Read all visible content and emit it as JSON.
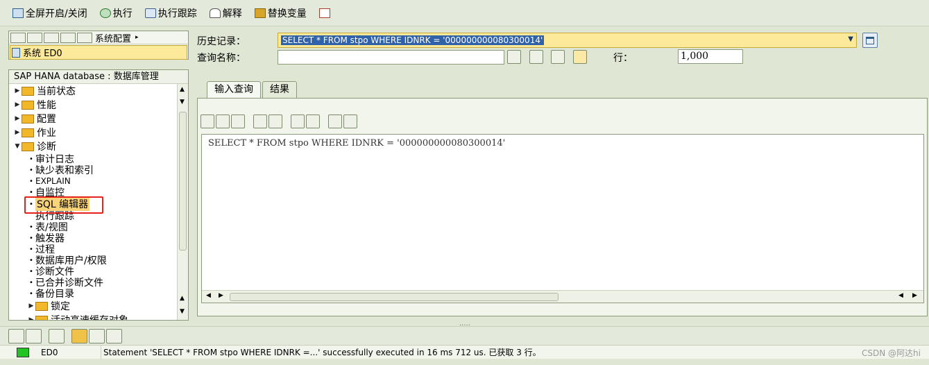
{
  "toolbar": {
    "fullscreen": "全屏开启/关闭",
    "execute": "执行",
    "exec_trace": "执行跟踪",
    "explain": "解释",
    "replace_vars": "替换变量"
  },
  "nav": {
    "system_config": "系统配置",
    "system": "系统 ED0"
  },
  "tree": {
    "header": "SAP HANA database : 数据库管理",
    "folders": {
      "current_state": "当前状态",
      "performance": "性能",
      "config": "配置",
      "jobs": "作业",
      "diagnosis": "诊断",
      "lock": "锁定",
      "active_cache": "活动高速缓存对象"
    },
    "leaves": {
      "audit_log": "审计日志",
      "missing_tables": "缺少表和索引",
      "explain": "EXPLAIN",
      "self_monitor": "自监控",
      "sql_editor": "SQL 编辑器",
      "exec_trace": "执行跟踪",
      "tables_views": "表/视图",
      "triggers": "触发器",
      "procedures": "过程",
      "db_users": "数据库用户/权限",
      "diag_files": "诊断文件",
      "merged_diag_files": "已合并诊断文件",
      "backup_catalog": "备份目录"
    }
  },
  "form": {
    "history_label": "历史记录：",
    "history_value": "SELECT * FROM stpo WHERE IDNRK = '000000000080300014'",
    "query_name_label": "查询名称：",
    "query_name_value": "",
    "rows_label": "行：",
    "rows_value": "1,000"
  },
  "tabs": {
    "input_query": "输入查询",
    "results": "结果"
  },
  "editor": {
    "text": "SELECT * FROM stpo WHERE IDNRK = '000000000080300014'"
  },
  "status": {
    "system": "ED0",
    "message": "Statement 'SELECT * FROM stpo WHERE IDNRK =...' successfully executed in 16 ms 712 us. 已获取 3 行。",
    "light_color": "#22c322"
  },
  "watermark": "CSDN @阿达hi",
  "colors": {
    "highlight_border": "#e8211b",
    "selection_bg": "#2f62a8",
    "input_yellow": "#fde99a"
  }
}
